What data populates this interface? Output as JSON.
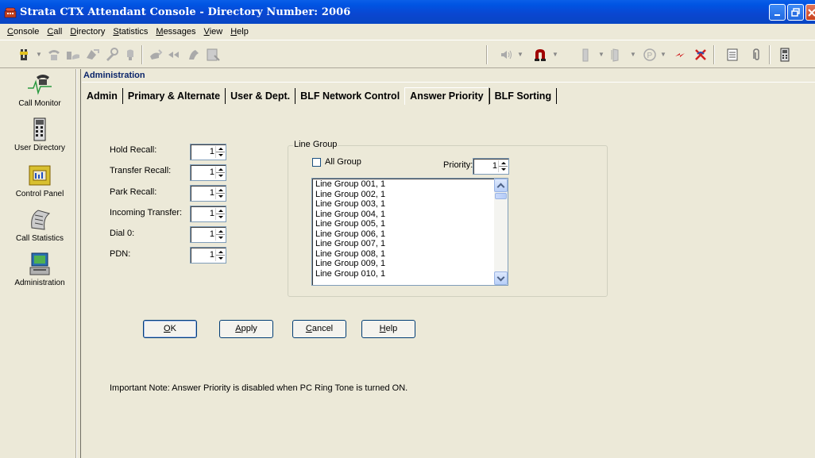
{
  "window": {
    "title": "Strata CTX Attendant Console - Directory Number: 2006"
  },
  "menu": {
    "items": [
      {
        "accel": "C",
        "rest": "onsole"
      },
      {
        "accel": "C",
        "rest": "all"
      },
      {
        "accel": "D",
        "rest": "irectory"
      },
      {
        "accel": "S",
        "rest": "tatistics"
      },
      {
        "accel": "M",
        "rest": "essages"
      },
      {
        "accel": "V",
        "rest": "iew"
      },
      {
        "accel": "H",
        "rest": "elp"
      }
    ]
  },
  "sidebar": {
    "items": [
      {
        "label": "Call Monitor"
      },
      {
        "label": "User Directory"
      },
      {
        "label": "Control Panel"
      },
      {
        "label": "Call Statistics"
      },
      {
        "label": "Administration"
      }
    ]
  },
  "main": {
    "section_title": "Administration",
    "tabs": [
      "Admin",
      "Primary & Alternate",
      "User & Dept.",
      "BLF Network Control",
      "Answer Priority",
      "BLF Sorting"
    ],
    "active_tab": "Answer Priority",
    "fields": [
      {
        "label": "Hold Recall:",
        "value": "1"
      },
      {
        "label": "Transfer Recall:",
        "value": "1"
      },
      {
        "label": "Park Recall:",
        "value": "1"
      },
      {
        "label": "Incoming Transfer:",
        "value": "1"
      },
      {
        "label": "Dial 0:",
        "value": "1"
      },
      {
        "label": "PDN:",
        "value": "1"
      }
    ],
    "line_group": {
      "title": "Line Group",
      "all_group_label": "All Group",
      "all_group_checked": false,
      "priority_label": "Priority:",
      "priority_value": "1",
      "items": [
        "Line Group 001,  1",
        "Line Group 002,  1",
        "Line Group 003,  1",
        "Line Group 004,  1",
        "Line Group 005,  1",
        "Line Group 006,  1",
        "Line Group 007,  1",
        "Line Group 008,  1",
        "Line Group 009,  1",
        "Line Group 010,  1"
      ]
    },
    "buttons": {
      "ok": {
        "accel": "O",
        "rest": "K"
      },
      "apply": {
        "accel": "A",
        "rest": "pply"
      },
      "cancel": {
        "accel": "C",
        "rest": "ancel"
      },
      "help": {
        "accel": "H",
        "rest": "elp"
      }
    },
    "note": "Important Note:  Answer Priority is disabled when PC Ring Tone is turned ON."
  },
  "colors": {
    "titlebar": "#0054e3",
    "section_title": "#0a246a",
    "window_bg": "#ece9d8"
  }
}
